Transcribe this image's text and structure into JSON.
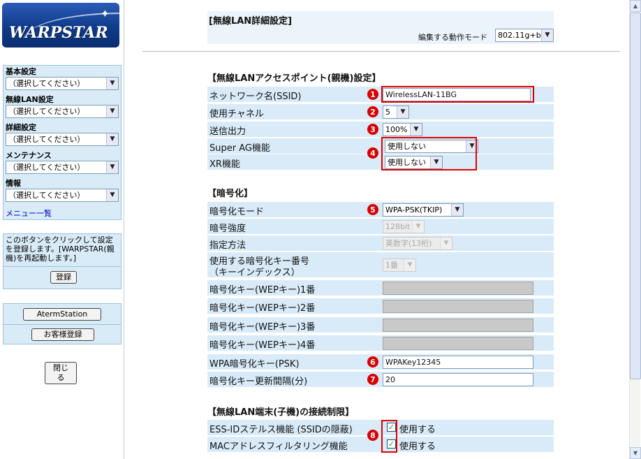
{
  "logo": {
    "text": "WARPSTAR"
  },
  "nav": {
    "groups": [
      {
        "label": "基本設定",
        "select": "（選択してください）"
      },
      {
        "label": "無線LAN設定",
        "select": "（選択してください）"
      },
      {
        "label": "詳細設定",
        "select": "（選択してください）"
      },
      {
        "label": "メンテナンス",
        "select": "（選択してください）"
      },
      {
        "label": "情報",
        "select": "（選択してください）"
      }
    ],
    "menu_list": "メニュー一覧"
  },
  "register": {
    "text": "このボタンをクリックして設定を登録します。[WARPSTAR(親機)を再起動します。]",
    "button": "登録"
  },
  "links": {
    "aterm_station": "AtermStation",
    "customer_register": "お客様登録"
  },
  "close_button": "閉じる",
  "header": {
    "title": "[無線LAN詳細設定]",
    "mode_label": "編集する動作モード",
    "mode_value": "802.11g+b"
  },
  "ap_section": {
    "title": "【無線LANアクセスポイント(親機)設定】",
    "ssid_label": "ネットワーク名(SSID)",
    "ssid_value": "WirelessLAN-11BG",
    "channel_label": "使用チャネル",
    "channel_value": "5",
    "power_label": "送信出力",
    "power_value": "100%",
    "super_ag_label": "Super AG機能",
    "super_ag_value": "使用しない",
    "xr_label": "XR機能",
    "xr_value": "使用しない"
  },
  "enc_section": {
    "title": "【暗号化】",
    "mode_label": "暗号化モード",
    "mode_value": "WPA-PSK(TKIP)",
    "strength_label": "暗号強度",
    "strength_value": "128bit",
    "method_label": "指定方法",
    "method_value": "英数字(13桁)",
    "keyindex_label_1": "使用する暗号化キー番号",
    "keyindex_label_2": "（キーインデックス）",
    "keyindex_value": "1番",
    "wep1_label": "暗号化キー(WEPキー)1番",
    "wep2_label": "暗号化キー(WEPキー)2番",
    "wep3_label": "暗号化キー(WEPキー)3番",
    "wep4_label": "暗号化キー(WEPキー)4番",
    "psk_label": "WPA暗号化キー(PSK)",
    "psk_value": "WPAKey12345",
    "interval_label": "暗号化キー更新間隔(分)",
    "interval_value": "20"
  },
  "client_section": {
    "title": "【無線LAN端末(子機)の接続制限】",
    "stealth_label": "ESS-IDステルス機能 (SSIDの隠蔽)",
    "stealth_check": "使用する",
    "mac_label": "MACアドレスフィルタリング機能",
    "mac_check": "使用する"
  },
  "badges": [
    "1",
    "2",
    "3",
    "4",
    "5",
    "6",
    "7",
    "8"
  ],
  "colors": {
    "accent_red": "#d80000",
    "row_bg": "#d9ebf8",
    "nav_bg": "#d8ebf7"
  }
}
